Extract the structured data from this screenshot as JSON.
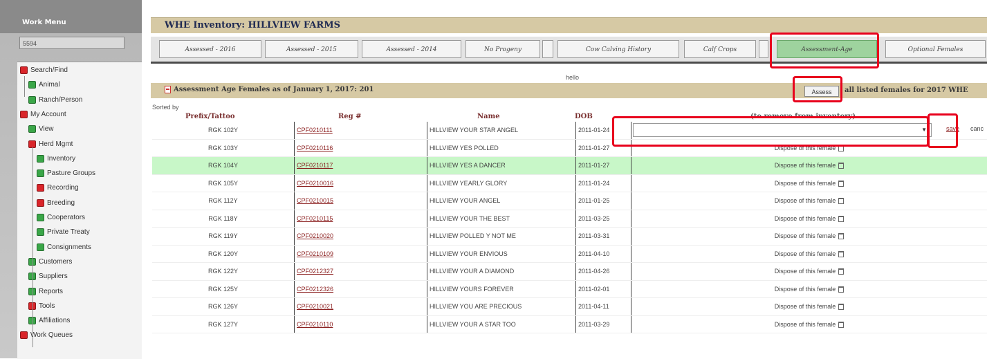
{
  "sidebar": {
    "title": "Work Menu",
    "search_value": "5594",
    "items": [
      {
        "label": "Search/Find",
        "color": "red"
      },
      {
        "label": "Animal",
        "color": "green"
      },
      {
        "label": "Ranch/Person",
        "color": "green"
      },
      {
        "label": "My Account",
        "color": "red"
      },
      {
        "label": "View",
        "color": "green"
      },
      {
        "label": "Herd Mgmt",
        "color": "red"
      },
      {
        "label": "Inventory",
        "color": "green"
      },
      {
        "label": "Pasture Groups",
        "color": "green"
      },
      {
        "label": "Recording",
        "color": "red"
      },
      {
        "label": "Breeding",
        "color": "red"
      },
      {
        "label": "Cooperators",
        "color": "green"
      },
      {
        "label": "Private Treaty",
        "color": "green"
      },
      {
        "label": "Consignments",
        "color": "green"
      },
      {
        "label": "Customers",
        "color": "green"
      },
      {
        "label": "Suppliers",
        "color": "green"
      },
      {
        "label": "Reports",
        "color": "green"
      },
      {
        "label": "Tools",
        "color": "red"
      },
      {
        "label": "Affiliations",
        "color": "green"
      },
      {
        "label": "Work Queues",
        "color": "red"
      }
    ]
  },
  "header": {
    "title": "WHE Inventory: HILLVIEW FARMS"
  },
  "tabs": [
    {
      "label": "Assessed - 2016"
    },
    {
      "label": "Assessed - 2015"
    },
    {
      "label": "Assessed - 2014"
    },
    {
      "label": "No Progeny"
    },
    {
      "label": ""
    },
    {
      "label": "Cow Calving History"
    },
    {
      "label": "Calf Crops"
    },
    {
      "label": ""
    },
    {
      "label": "Assessment-Age",
      "active": true
    },
    {
      "label": "Optional Females"
    }
  ],
  "hello_text": "hello",
  "section": {
    "title": "Assessment Age Females as of January 1, 2017: 201",
    "assess_button": "Assess",
    "assess_text": "all listed females for 2017 WHE"
  },
  "sorted_by": "Sorted by",
  "columns": {
    "tattoo": "Prefix/Tattoo",
    "reg": "Reg #",
    "name": "Name",
    "dob": "DOB",
    "action": "(to remove from inventory)"
  },
  "first_row_actions": {
    "save": "save",
    "cancel": "canc"
  },
  "dispose_label": "Dispose of this female",
  "rows": [
    {
      "tattoo": "RGK 102Y",
      "reg": "CPF0210111",
      "name": "HILLVIEW YOUR STAR ANGEL",
      "dob": "2011-01-24",
      "editing": true
    },
    {
      "tattoo": "RGK 103Y",
      "reg": "CPF0210116",
      "name": "HILLVIEW YES POLLED",
      "dob": "2011-01-27"
    },
    {
      "tattoo": "RGK 104Y",
      "reg": "CPF0210117",
      "name": "HILLVIEW YES A DANCER",
      "dob": "2011-01-27",
      "highlight": true
    },
    {
      "tattoo": "RGK 105Y",
      "reg": "CPF0210016",
      "name": "HILLVIEW YEARLY GLORY",
      "dob": "2011-01-24"
    },
    {
      "tattoo": "RGK 112Y",
      "reg": "CPF0210015",
      "name": "HILLVIEW YOUR ANGEL",
      "dob": "2011-01-25"
    },
    {
      "tattoo": "RGK 118Y",
      "reg": "CPF0210115",
      "name": "HILLVIEW YOUR THE BEST",
      "dob": "2011-03-25"
    },
    {
      "tattoo": "RGK 119Y",
      "reg": "CPF0210020",
      "name": "HILLVIEW POLLED Y NOT ME",
      "dob": "2011-03-31"
    },
    {
      "tattoo": "RGK 120Y",
      "reg": "CPF0210109",
      "name": "HILLVIEW YOUR ENVIOUS",
      "dob": "2011-04-10"
    },
    {
      "tattoo": "RGK 122Y",
      "reg": "CPF0212327",
      "name": "HILLVIEW YOUR A DIAMOND",
      "dob": "2011-04-26"
    },
    {
      "tattoo": "RGK 125Y",
      "reg": "CPF0212326",
      "name": "HILLVIEW YOURS FOREVER",
      "dob": "2011-02-01"
    },
    {
      "tattoo": "RGK 126Y",
      "reg": "CPF0210021",
      "name": "HILLVIEW YOU ARE PRECIOUS",
      "dob": "2011-04-11"
    },
    {
      "tattoo": "RGK 127Y",
      "reg": "CPF0210110",
      "name": "HILLVIEW YOUR A STAR TOO",
      "dob": "2011-03-29"
    }
  ]
}
